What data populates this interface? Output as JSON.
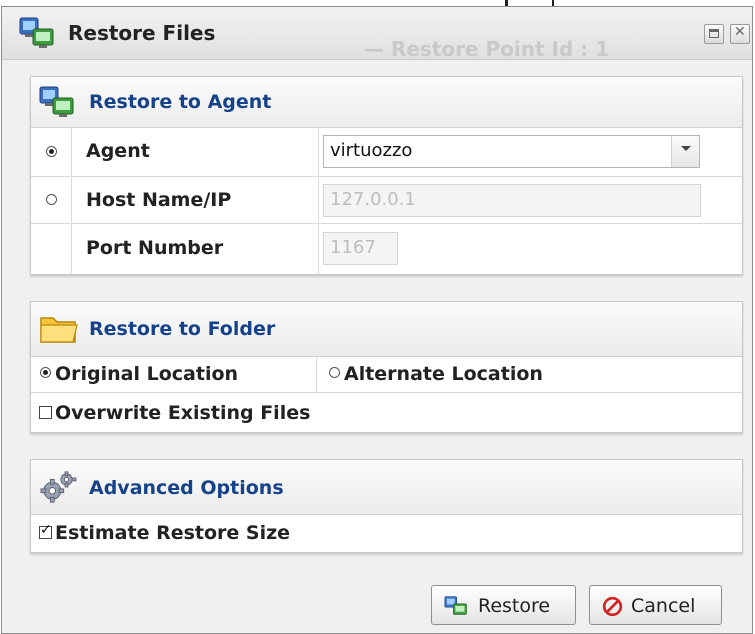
{
  "window": {
    "title": "Restore Files",
    "ghost_title": "— Restore Point Id : 1"
  },
  "sections": {
    "agent": {
      "title": "Restore to Agent",
      "rows": [
        {
          "label": "Agent",
          "selected": true,
          "value": "virtuozzo"
        },
        {
          "label": "Host Name/IP",
          "selected": false,
          "value": "127.0.0.1"
        },
        {
          "label": "Port Number",
          "value": "1167"
        }
      ]
    },
    "folder": {
      "title": "Restore to Folder",
      "original_label": "Original Location",
      "original_selected": true,
      "alternate_label": "Alternate Location",
      "alternate_selected": false,
      "overwrite_label": "Overwrite Existing Files",
      "overwrite_checked": false
    },
    "advanced": {
      "title": "Advanced Options",
      "estimate_label": "Estimate Restore Size",
      "estimate_checked": true
    }
  },
  "buttons": {
    "restore": "Restore",
    "cancel": "Cancel"
  },
  "icons": {
    "title": "agent-computers-icon",
    "agent_section": "agent-computers-icon",
    "folder_section": "folder-icon",
    "advanced_section": "gears-icon",
    "restore_button": "agent-computers-icon",
    "cancel_button": "no-entry-icon"
  },
  "colors": {
    "section_title": "#15428b",
    "cancel_icon": "#d42020"
  }
}
